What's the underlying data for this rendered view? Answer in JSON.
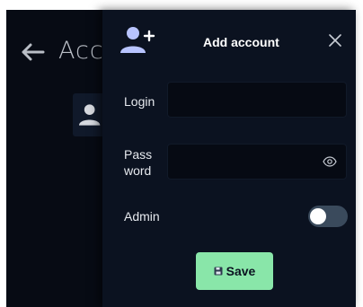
{
  "background": {
    "title": "Acc"
  },
  "dialog": {
    "title": "Add account",
    "fields": {
      "login_label": "Login",
      "login_value": "",
      "password_label_line1": "Pass",
      "password_label_line2": "word",
      "password_value": "",
      "admin_label": "Admin",
      "admin_enabled": false
    },
    "save_label": "Save"
  },
  "colors": {
    "app_bg": "#070b14",
    "dialog_bg": "#0b1220",
    "save_bg": "#89e6a9",
    "accent_icon": "#b8c4ff"
  }
}
